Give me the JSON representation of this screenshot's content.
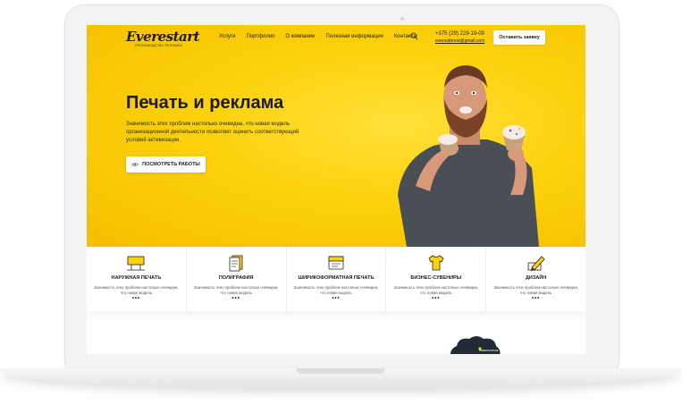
{
  "header": {
    "logo_text": "Everestart",
    "logo_subtitle": "ПРОИЗВОДСТВО РЕКЛАМЫ",
    "nav": [
      "Услуги",
      "Портфолио",
      "О компании",
      "Полезная информация",
      "Контакты"
    ],
    "phone": "+375 (29) 229-19-09",
    "email": "everestbrest@gmail.com",
    "cta_label": "Оставить заявку"
  },
  "hero": {
    "title": "Печать и реклама",
    "description": "Значимость этих проблем настолько очевидна, что новая модель организационной деятельности позволяет оценить соответствующий условий активизации.",
    "button_label": "ПОСМОТРЕТЬ РАБОТЫ"
  },
  "services": [
    {
      "title": "НАРУЖНАЯ ПЕЧАТЬ",
      "desc": "Значимость этих проблем настолько очевидна, что новая модель",
      "more": "•••",
      "icon": "billboard-icon"
    },
    {
      "title": "ПОЛИГРАФИЯ",
      "desc": "Значимость этих проблем настолько очевидна, что новая модель",
      "more": "•••",
      "icon": "documents-icon"
    },
    {
      "title": "ШИРИКОФОРМАТНАЯ ПЕЧАТЬ",
      "desc": "Значимость этих проблем настолько очевидна, что новая модель",
      "more": "•••",
      "icon": "wide-print-icon"
    },
    {
      "title": "БИЗНЕС-СУВЕНИРЫ",
      "desc": "Значимость этих проблем настолько очевидна, что новая модель",
      "more": "•••",
      "icon": "tshirt-icon"
    },
    {
      "title": "ДИЗАЙН",
      "desc": "Значимость этих проблем настолько очевидна, что новая модель",
      "more": "•••",
      "icon": "pencil-icon"
    }
  ],
  "map": {
    "label": "Новопоселок"
  },
  "colors": {
    "accent": "#fdd10b",
    "text": "#1a1a1a"
  }
}
